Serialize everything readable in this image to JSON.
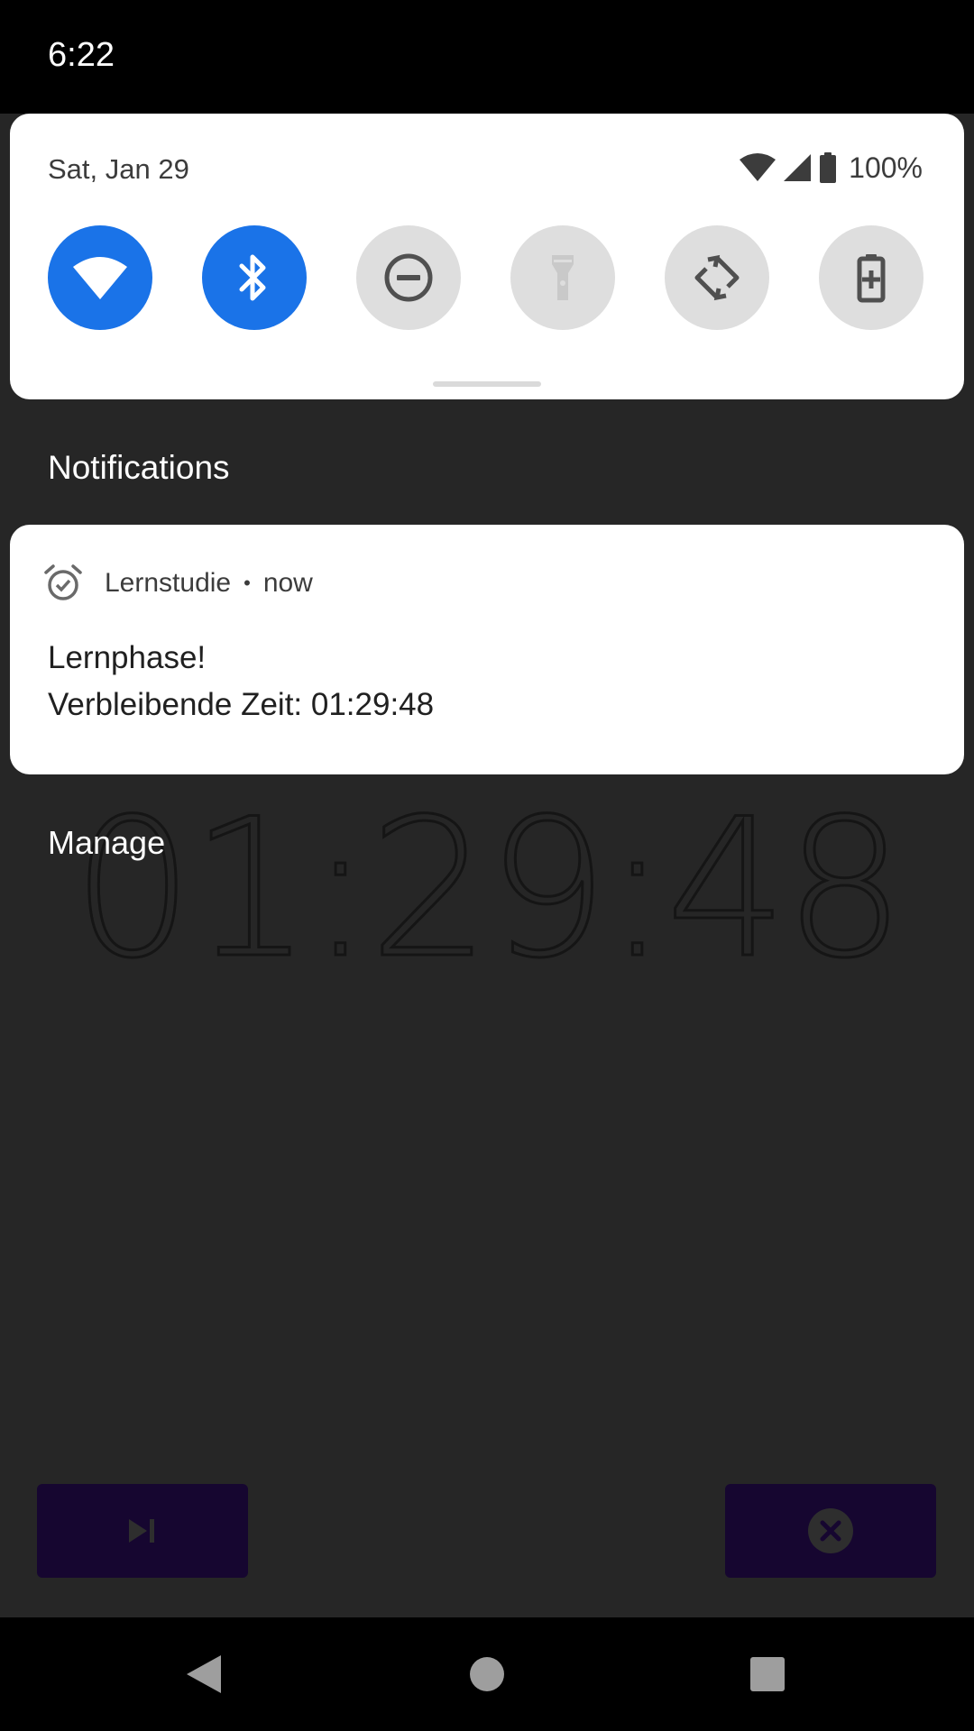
{
  "status_bar": {
    "time": "6:22"
  },
  "quick_settings": {
    "date": "Sat, Jan 29",
    "battery_percent": "100%",
    "tiles": [
      {
        "name": "wifi",
        "icon": "wifi-icon",
        "active": true
      },
      {
        "name": "bluetooth",
        "icon": "bluetooth-icon",
        "active": true
      },
      {
        "name": "do-not-disturb",
        "icon": "dnd-icon",
        "active": false
      },
      {
        "name": "flashlight",
        "icon": "flashlight-icon",
        "active": false
      },
      {
        "name": "auto-rotate",
        "icon": "auto-rotate-icon",
        "active": false
      },
      {
        "name": "battery-saver",
        "icon": "battery-saver-icon",
        "active": false
      }
    ],
    "colors": {
      "active_tile": "#1a73e8",
      "inactive_tile": "#dedede"
    }
  },
  "notifications": {
    "header": "Notifications",
    "items": [
      {
        "app_name": "Lernstudie",
        "separator": "•",
        "time": "now",
        "title": "Lernphase!",
        "text": "Verbleibende Zeit: 01:29:48",
        "icon": "alarm-check-icon"
      }
    ],
    "manage_label": "Manage"
  },
  "background_app": {
    "timer": "01:29:48",
    "buttons": [
      {
        "name": "skip",
        "icon": "skip-next-icon"
      },
      {
        "name": "cancel",
        "icon": "close-circle-icon"
      }
    ],
    "button_color": "#160630"
  },
  "nav_bar": {
    "buttons": [
      "back",
      "home",
      "recents"
    ]
  }
}
